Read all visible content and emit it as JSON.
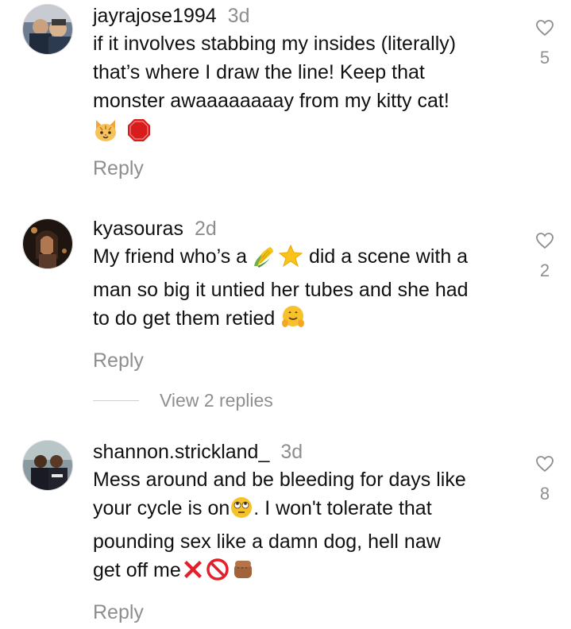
{
  "comments": [
    {
      "username": "jayrajose1994",
      "time": "3d",
      "lines": [
        "if it involves stabbing my insides (literally)",
        "that’s where I draw the line! Keep that",
        "monster awaaaaaaaay from my kitty cat!"
      ],
      "emojis": [
        "cat-face-emoji",
        "stop-sign-emoji"
      ],
      "reply_label": "Reply",
      "likes": "5"
    },
    {
      "username": "kyasouras",
      "time": "2d",
      "line1_before": "My friend who’s a ",
      "line1_emojis": [
        "corn-emoji",
        "star-emoji"
      ],
      "line1_after": " did a scene with a",
      "line2": "man so big it untied her tubes and she had",
      "line3": "to do get them retied ",
      "line3_emoji": "melting-hug-emoji",
      "reply_label": "Reply",
      "likes": "2",
      "view_replies": "View 2 replies"
    },
    {
      "username": "shannon.strickland_",
      "time": "3d",
      "line1": "Mess around and be bleeding for days like",
      "line2_before": "your cycle is on",
      "line2_emoji": "eye-roll-emoji",
      "line2_after": ". I won't tolerate that",
      "line3": "pounding sex like a damn dog, hell naw",
      "line4": "get off me",
      "line4_emojis": [
        "cross-mark-emoji",
        "no-entry-emoji",
        "fist-emoji"
      ],
      "reply_label": "Reply",
      "likes": "8"
    }
  ],
  "colors": {
    "text": "#111111",
    "muted": "#8e8e8e",
    "background": "#ffffff"
  }
}
